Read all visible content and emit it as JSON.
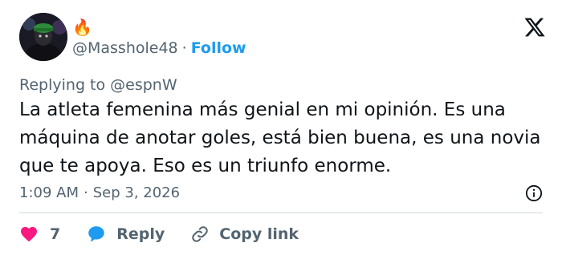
{
  "author": {
    "display_name": "🔥",
    "handle": "@Masshole48",
    "separator": "·",
    "follow_label": "Follow"
  },
  "tweet": {
    "replying_to": "Replying to @espnW",
    "text": "La atleta femenina más genial en mi opinión. Es una máquina de anotar goles, está bien buena, es una novia que te apoya. Eso es un triunfo enorme.",
    "time": "1:09 AM",
    "date_separator": "·",
    "date": "Sep 3, 2026"
  },
  "actions": {
    "like_count": "7",
    "reply_label": "Reply",
    "copy_link_label": "Copy link"
  },
  "icons": {
    "logo": "x-logo-icon",
    "info": "info-icon",
    "like": "heart-icon",
    "reply": "reply-bubble-icon",
    "copy": "link-icon"
  },
  "colors": {
    "follow": "#1d9bf0",
    "like": "#f91880",
    "reply": "#1d9bf0",
    "muted": "#536471",
    "text": "#0f1419"
  }
}
